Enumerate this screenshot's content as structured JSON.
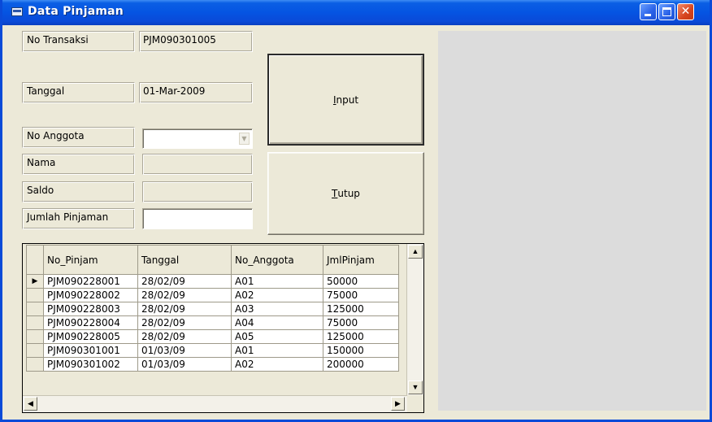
{
  "window": {
    "title": "Data Pinjaman"
  },
  "form": {
    "no_transaksi_label": "No Transaksi",
    "no_transaksi_value": "PJM090301005",
    "tanggal_label": "Tanggal",
    "tanggal_value": "01-Mar-2009",
    "no_anggota_label": "No Anggota",
    "nama_label": "Nama",
    "saldo_label": "Saldo",
    "jumlah_pinjaman_label": "Jumlah Pinjaman"
  },
  "buttons": {
    "input_mnemonic": "I",
    "input_rest": "nput",
    "tutup_mnemonic": "T",
    "tutup_rest": "utup"
  },
  "grid": {
    "columns": [
      "No_Pinjam",
      "Tanggal",
      "No_Anggota",
      "JmlPinjam"
    ],
    "current_row_marker": "▶",
    "rows": [
      [
        "PJM090228001",
        "28/02/09",
        "A01",
        "50000"
      ],
      [
        "PJM090228002",
        "28/02/09",
        "A02",
        "75000"
      ],
      [
        "PJM090228003",
        "28/02/09",
        "A03",
        "125000"
      ],
      [
        "PJM090228004",
        "28/02/09",
        "A04",
        "75000"
      ],
      [
        "PJM090228005",
        "28/02/09",
        "A05",
        "125000"
      ],
      [
        "PJM090301001",
        "01/03/09",
        "A01",
        "150000"
      ],
      [
        "PJM090301002",
        "01/03/09",
        "A02",
        "200000"
      ]
    ]
  },
  "colors": {
    "titlebar": "#0554e2",
    "window_bg": "#ece9d8",
    "panel_gray": "#dcdcdc"
  },
  "icons": [
    "window-app-icon",
    "minimize-icon",
    "maximize-icon",
    "close-icon",
    "combo-arrow-icon",
    "scroll-up-icon",
    "scroll-down-icon",
    "scroll-left-icon",
    "scroll-right-icon",
    "row-pointer-icon"
  ]
}
